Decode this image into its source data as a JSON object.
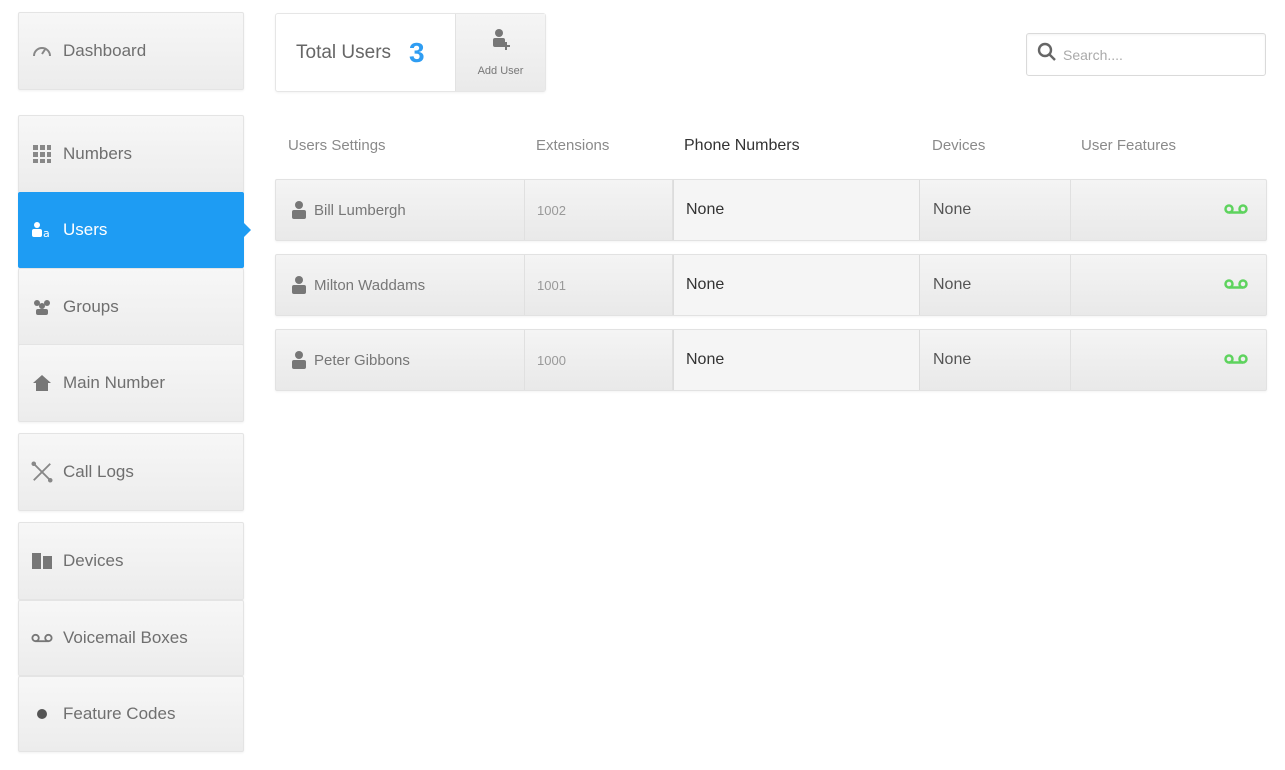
{
  "sidebar": {
    "items": [
      {
        "label": "Dashboard",
        "icon": "dashboard-icon",
        "active": false
      },
      {
        "label": "Numbers",
        "icon": "grid-icon",
        "active": false
      },
      {
        "label": "Users",
        "icon": "users-icon",
        "active": true
      },
      {
        "label": "Groups",
        "icon": "groups-icon",
        "active": false
      },
      {
        "label": "Main Number",
        "icon": "home-icon",
        "active": false
      },
      {
        "label": "Call Logs",
        "icon": "call-logs-icon",
        "active": false
      },
      {
        "label": "Devices",
        "icon": "devices-icon",
        "active": false
      },
      {
        "label": "Voicemail Boxes",
        "icon": "voicemail-icon",
        "active": false
      },
      {
        "label": "Feature Codes",
        "icon": "feature-codes-icon",
        "active": false
      }
    ]
  },
  "header": {
    "total_label": "Total Users",
    "total_count": "3",
    "add_user_label": "Add User"
  },
  "search": {
    "placeholder": "Search....",
    "value": ""
  },
  "table": {
    "columns": [
      "Users Settings",
      "Extensions",
      "Phone Numbers",
      "Devices",
      "User Features"
    ],
    "rows": [
      {
        "name": "Bill Lumbergh",
        "extension": "1002",
        "phone": "None",
        "devices": "None"
      },
      {
        "name": "Milton Waddams",
        "extension": "1001",
        "phone": "None",
        "devices": "None"
      },
      {
        "name": "Peter Gibbons",
        "extension": "1000",
        "phone": "None",
        "devices": "None"
      }
    ]
  },
  "colors": {
    "accent": "#1e9cf3",
    "count": "#2f9df2",
    "voicemail": "#5ed35e"
  }
}
